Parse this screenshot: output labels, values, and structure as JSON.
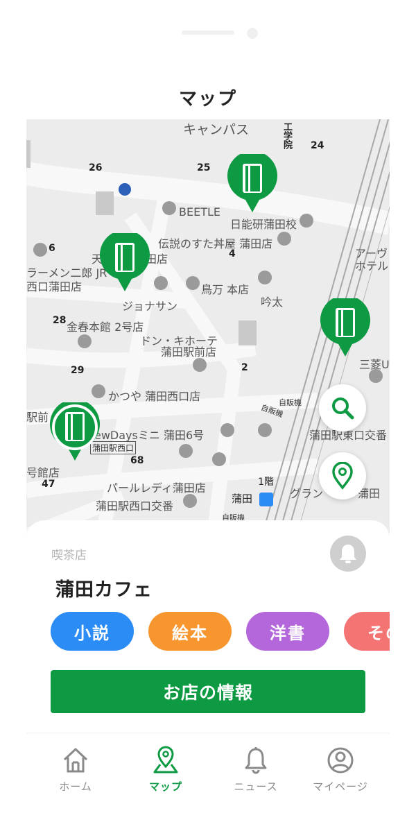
{
  "header": {
    "title": "マップ"
  },
  "map": {
    "labels": {
      "campus": "キャンパス",
      "kogakuin": "工学院",
      "beetle": "BEETLE",
      "nihon_noken": "日能研蒲田校",
      "densetsu": "伝説のすた丼屋 蒲田店",
      "ramen": "ラーメン二郎 JR",
      "ramen2": "西口蒲田店",
      "ten": "天",
      "tadaten": "田店",
      "jonathan": "ジョナサン",
      "torimanhonten": "鳥万 本店",
      "ginta": "吟太",
      "kinharu": "金春本館 2号店",
      "donki1": "ドン・キホーテ",
      "donki2": "蒲田駅前店",
      "katsuya": "かつや 蒲田西口店",
      "newdays": "ewDaysミニ 蒲田6号",
      "nishiguchi": "蒲田駅西口",
      "ekimae": "駅前",
      "gokan": "号館店",
      "pearl": "パールレディ蒲田店",
      "koban": "蒲田駅西口交番",
      "kamata": "蒲田",
      "floor1": "1階",
      "grand": "グラン",
      "kamata2": "蒲田",
      "higashiguchi": "蒲田駅東口交番",
      "mitsubishi": "三菱U",
      "apa1": "アーヴ",
      "apa2": "ホテル",
      "vending1": "自販機",
      "vending2": "自販機",
      "vending3": "自販機"
    },
    "numbers": [
      "24",
      "26",
      "25",
      "6",
      "4",
      "28",
      "29",
      "2",
      "68",
      "47"
    ]
  },
  "shop": {
    "category": "喫茶店",
    "name": "蒲田カフェ",
    "genres": [
      {
        "label": "小説",
        "color": "#2b8cf5"
      },
      {
        "label": "絵本",
        "color": "#f7962f"
      },
      {
        "label": "洋書",
        "color": "#b467db"
      },
      {
        "label": "その",
        "color": "#f47373"
      }
    ],
    "info_button": "お店の情報"
  },
  "tabs": [
    {
      "label": "ホーム",
      "icon": "home-icon"
    },
    {
      "label": "マップ",
      "icon": "map-pin-icon"
    },
    {
      "label": "ニュース",
      "icon": "bell-icon"
    },
    {
      "label": "マイページ",
      "icon": "user-icon"
    }
  ],
  "colors": {
    "brand_green": "#0e9a43",
    "map_bg": "#ececec"
  }
}
